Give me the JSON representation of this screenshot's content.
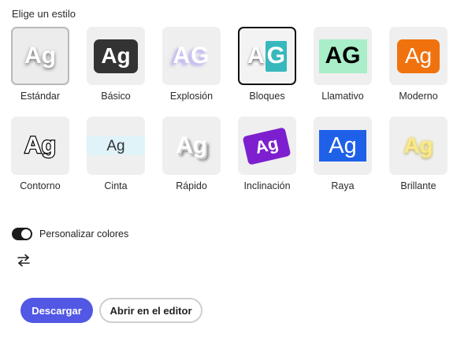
{
  "heading": "Elige un estilo",
  "styles": [
    {
      "label": "Estándar",
      "sample": "Ag"
    },
    {
      "label": "Básico",
      "sample": "Ag"
    },
    {
      "label": "Explosión",
      "sample": "AG"
    },
    {
      "label": "Bloques",
      "sample_a": "A",
      "sample_g": "G"
    },
    {
      "label": "Llamativo",
      "sample": "AG"
    },
    {
      "label": "Moderno",
      "sample": "Ag"
    },
    {
      "label": "Contorno",
      "sample": "Ag"
    },
    {
      "label": "Cinta",
      "sample": "Ag"
    },
    {
      "label": "Rápido",
      "sample": "Ag"
    },
    {
      "label": "Inclinación",
      "sample": "Ag"
    },
    {
      "label": "Raya",
      "sample": "Ag"
    },
    {
      "label": "Brillante",
      "sample": "Ag"
    }
  ],
  "selected_style": "Estándar",
  "customize_colors": {
    "label": "Personalizar colores",
    "enabled": true
  },
  "swap_icon": "swap-arrows-icon",
  "buttons": {
    "download": "Descargar",
    "open_editor": "Abrir en el editor"
  },
  "colors": {
    "primary": "#5258e4",
    "basico": "#333333",
    "bloques": "#37b8bd",
    "llamativo": "#a9eec8",
    "moderno": "#f0720e",
    "inclinacion": "#7d1fcf",
    "raya": "#1f60e9",
    "brillante": "#fae98a"
  }
}
